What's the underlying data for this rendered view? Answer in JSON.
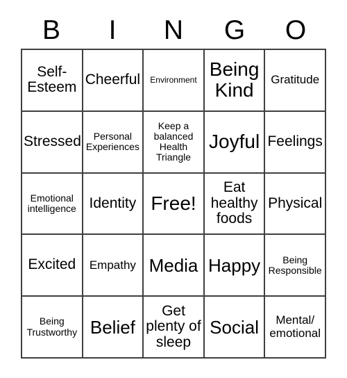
{
  "card": {
    "header_letters": [
      "B",
      "I",
      "N",
      "G",
      "O"
    ],
    "rows": [
      [
        {
          "text": "Self-\nEsteem",
          "size": "md"
        },
        {
          "text": "Cheerful",
          "size": "md"
        },
        {
          "text": "Environment",
          "size": "xxs"
        },
        {
          "text": "Being\nKind",
          "size": "xl"
        },
        {
          "text": "Gratitude",
          "size": "sm"
        }
      ],
      [
        {
          "text": "Stressed",
          "size": "md"
        },
        {
          "text": "Personal\nExperiences",
          "size": "xs"
        },
        {
          "text": "Keep a\nbalanced\nHealth\nTriangle",
          "size": "xs"
        },
        {
          "text": "Joyful",
          "size": "xl"
        },
        {
          "text": "Feelings",
          "size": "md"
        }
      ],
      [
        {
          "text": "Emotional\nintelligence",
          "size": "xs"
        },
        {
          "text": "Identity",
          "size": "md"
        },
        {
          "text": "Free!",
          "size": "xl"
        },
        {
          "text": "Eat\nhealthy\nfoods",
          "size": "md"
        },
        {
          "text": "Physical",
          "size": "md"
        }
      ],
      [
        {
          "text": "Excited",
          "size": "md"
        },
        {
          "text": "Empathy",
          "size": "sm"
        },
        {
          "text": "Media",
          "size": "lg"
        },
        {
          "text": "Happy",
          "size": "lg"
        },
        {
          "text": "Being\nResponsible",
          "size": "xs"
        }
      ],
      [
        {
          "text": "Being\nTrustworthy",
          "size": "xs"
        },
        {
          "text": "Belief",
          "size": "lg"
        },
        {
          "text": "Get\nplenty of\nsleep",
          "size": "md"
        },
        {
          "text": "Social",
          "size": "lg"
        },
        {
          "text": "Mental/\nemotional",
          "size": "sm"
        }
      ]
    ],
    "free_space_label": "Free!",
    "colors": {
      "background": "#ffffff",
      "border": "#3f3f3f",
      "text": "#000000"
    }
  }
}
